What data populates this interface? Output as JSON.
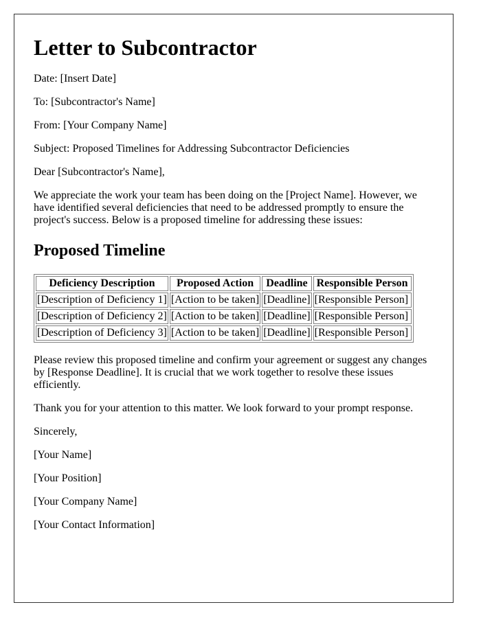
{
  "letter": {
    "title": "Letter to Subcontractor",
    "date_line": "Date: [Insert Date]",
    "to_line": "To: [Subcontractor's Name]",
    "from_line": "From: [Your Company Name]",
    "subject_line": "Subject: Proposed Timelines for Addressing Subcontractor Deficiencies",
    "salutation": "Dear [Subcontractor's Name],",
    "intro_paragraph": "We appreciate the work your team has been doing on the [Project Name]. However, we have identified several deficiencies that need to be addressed promptly to ensure the project's success. Below is a proposed timeline for addressing these issues:",
    "section_heading": "Proposed Timeline",
    "table": {
      "headers": [
        "Deficiency Description",
        "Proposed Action",
        "Deadline",
        "Responsible Person"
      ],
      "rows": [
        [
          "[Description of Deficiency 1]",
          "[Action to be taken]",
          "[Deadline]",
          "[Responsible Person]"
        ],
        [
          "[Description of Deficiency 2]",
          "[Action to be taken]",
          "[Deadline]",
          "[Responsible Person]"
        ],
        [
          "[Description of Deficiency 3]",
          "[Action to be taken]",
          "[Deadline]",
          "[Responsible Person]"
        ]
      ]
    },
    "review_paragraph": "Please review this proposed timeline and confirm your agreement or suggest any changes by [Response Deadline]. It is crucial that we work together to resolve these issues efficiently.",
    "thanks_paragraph": "Thank you for your attention to this matter. We look forward to your prompt response.",
    "closing": "Sincerely,",
    "signature": {
      "name": "[Your Name]",
      "position": "[Your Position]",
      "company": "[Your Company Name]",
      "contact": "[Your Contact Information]"
    }
  }
}
